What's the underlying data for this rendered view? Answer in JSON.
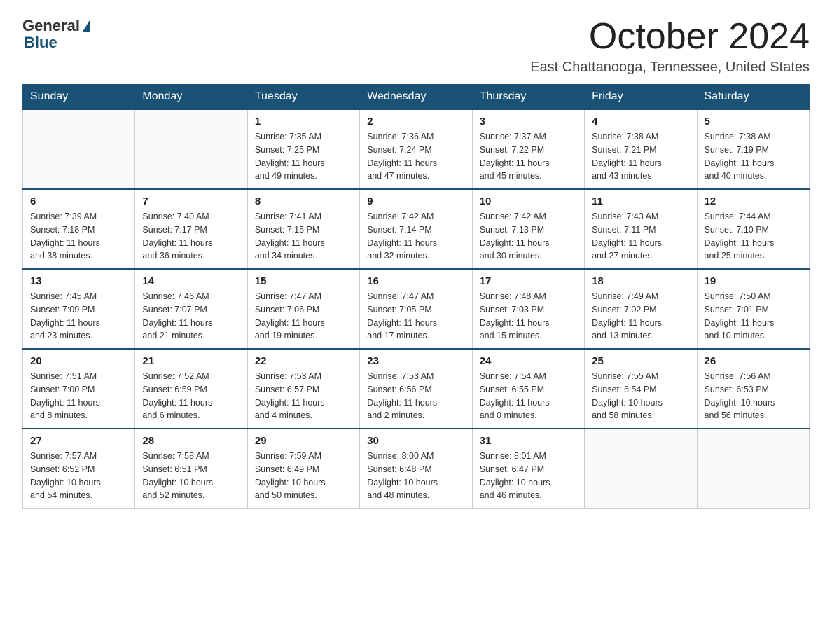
{
  "header": {
    "logo": {
      "general": "General",
      "blue": "Blue"
    },
    "title": "October 2024",
    "location": "East Chattanooga, Tennessee, United States"
  },
  "weekdays": [
    "Sunday",
    "Monday",
    "Tuesday",
    "Wednesday",
    "Thursday",
    "Friday",
    "Saturday"
  ],
  "weeks": [
    [
      {
        "day": "",
        "info": ""
      },
      {
        "day": "",
        "info": ""
      },
      {
        "day": "1",
        "info": "Sunrise: 7:35 AM\nSunset: 7:25 PM\nDaylight: 11 hours\nand 49 minutes."
      },
      {
        "day": "2",
        "info": "Sunrise: 7:36 AM\nSunset: 7:24 PM\nDaylight: 11 hours\nand 47 minutes."
      },
      {
        "day": "3",
        "info": "Sunrise: 7:37 AM\nSunset: 7:22 PM\nDaylight: 11 hours\nand 45 minutes."
      },
      {
        "day": "4",
        "info": "Sunrise: 7:38 AM\nSunset: 7:21 PM\nDaylight: 11 hours\nand 43 minutes."
      },
      {
        "day": "5",
        "info": "Sunrise: 7:38 AM\nSunset: 7:19 PM\nDaylight: 11 hours\nand 40 minutes."
      }
    ],
    [
      {
        "day": "6",
        "info": "Sunrise: 7:39 AM\nSunset: 7:18 PM\nDaylight: 11 hours\nand 38 minutes."
      },
      {
        "day": "7",
        "info": "Sunrise: 7:40 AM\nSunset: 7:17 PM\nDaylight: 11 hours\nand 36 minutes."
      },
      {
        "day": "8",
        "info": "Sunrise: 7:41 AM\nSunset: 7:15 PM\nDaylight: 11 hours\nand 34 minutes."
      },
      {
        "day": "9",
        "info": "Sunrise: 7:42 AM\nSunset: 7:14 PM\nDaylight: 11 hours\nand 32 minutes."
      },
      {
        "day": "10",
        "info": "Sunrise: 7:42 AM\nSunset: 7:13 PM\nDaylight: 11 hours\nand 30 minutes."
      },
      {
        "day": "11",
        "info": "Sunrise: 7:43 AM\nSunset: 7:11 PM\nDaylight: 11 hours\nand 27 minutes."
      },
      {
        "day": "12",
        "info": "Sunrise: 7:44 AM\nSunset: 7:10 PM\nDaylight: 11 hours\nand 25 minutes."
      }
    ],
    [
      {
        "day": "13",
        "info": "Sunrise: 7:45 AM\nSunset: 7:09 PM\nDaylight: 11 hours\nand 23 minutes."
      },
      {
        "day": "14",
        "info": "Sunrise: 7:46 AM\nSunset: 7:07 PM\nDaylight: 11 hours\nand 21 minutes."
      },
      {
        "day": "15",
        "info": "Sunrise: 7:47 AM\nSunset: 7:06 PM\nDaylight: 11 hours\nand 19 minutes."
      },
      {
        "day": "16",
        "info": "Sunrise: 7:47 AM\nSunset: 7:05 PM\nDaylight: 11 hours\nand 17 minutes."
      },
      {
        "day": "17",
        "info": "Sunrise: 7:48 AM\nSunset: 7:03 PM\nDaylight: 11 hours\nand 15 minutes."
      },
      {
        "day": "18",
        "info": "Sunrise: 7:49 AM\nSunset: 7:02 PM\nDaylight: 11 hours\nand 13 minutes."
      },
      {
        "day": "19",
        "info": "Sunrise: 7:50 AM\nSunset: 7:01 PM\nDaylight: 11 hours\nand 10 minutes."
      }
    ],
    [
      {
        "day": "20",
        "info": "Sunrise: 7:51 AM\nSunset: 7:00 PM\nDaylight: 11 hours\nand 8 minutes."
      },
      {
        "day": "21",
        "info": "Sunrise: 7:52 AM\nSunset: 6:59 PM\nDaylight: 11 hours\nand 6 minutes."
      },
      {
        "day": "22",
        "info": "Sunrise: 7:53 AM\nSunset: 6:57 PM\nDaylight: 11 hours\nand 4 minutes."
      },
      {
        "day": "23",
        "info": "Sunrise: 7:53 AM\nSunset: 6:56 PM\nDaylight: 11 hours\nand 2 minutes."
      },
      {
        "day": "24",
        "info": "Sunrise: 7:54 AM\nSunset: 6:55 PM\nDaylight: 11 hours\nand 0 minutes."
      },
      {
        "day": "25",
        "info": "Sunrise: 7:55 AM\nSunset: 6:54 PM\nDaylight: 10 hours\nand 58 minutes."
      },
      {
        "day": "26",
        "info": "Sunrise: 7:56 AM\nSunset: 6:53 PM\nDaylight: 10 hours\nand 56 minutes."
      }
    ],
    [
      {
        "day": "27",
        "info": "Sunrise: 7:57 AM\nSunset: 6:52 PM\nDaylight: 10 hours\nand 54 minutes."
      },
      {
        "day": "28",
        "info": "Sunrise: 7:58 AM\nSunset: 6:51 PM\nDaylight: 10 hours\nand 52 minutes."
      },
      {
        "day": "29",
        "info": "Sunrise: 7:59 AM\nSunset: 6:49 PM\nDaylight: 10 hours\nand 50 minutes."
      },
      {
        "day": "30",
        "info": "Sunrise: 8:00 AM\nSunset: 6:48 PM\nDaylight: 10 hours\nand 48 minutes."
      },
      {
        "day": "31",
        "info": "Sunrise: 8:01 AM\nSunset: 6:47 PM\nDaylight: 10 hours\nand 46 minutes."
      },
      {
        "day": "",
        "info": ""
      },
      {
        "day": "",
        "info": ""
      }
    ]
  ]
}
